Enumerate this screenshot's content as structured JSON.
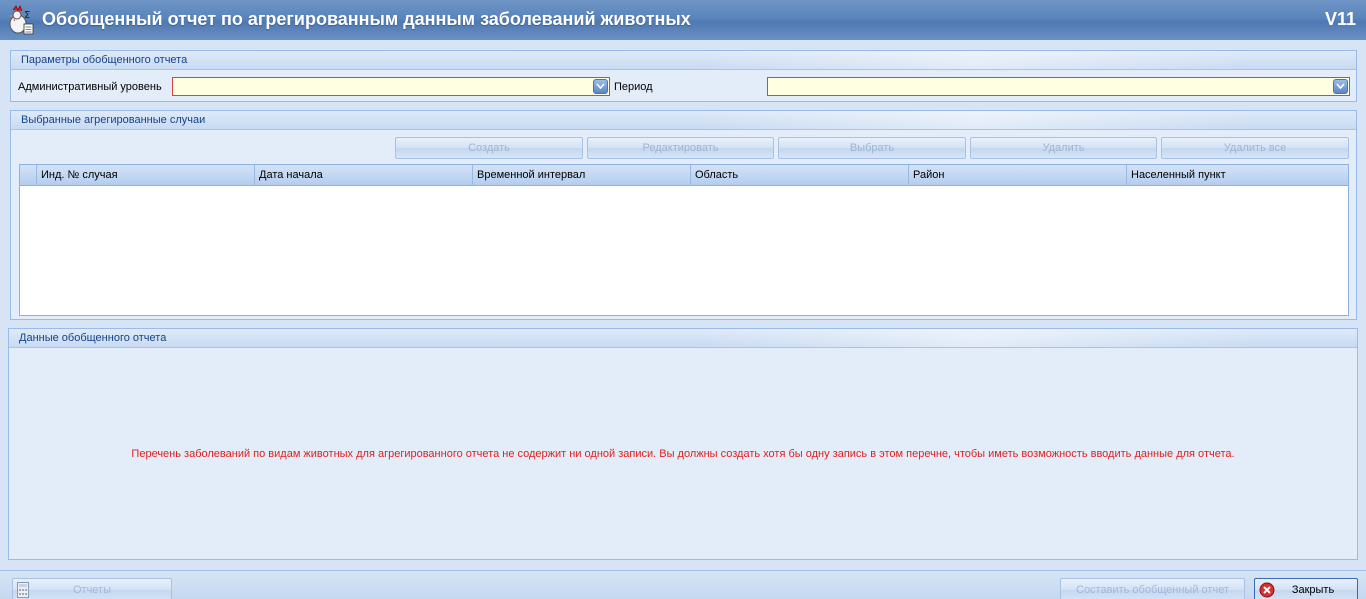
{
  "window": {
    "title": "Обобщенный отчет по агрегированным данным заболеваний животных",
    "version": "V11",
    "icon": "rooster-sigma-icon"
  },
  "params_panel": {
    "header": "Параметры обобщенного отчета",
    "admin_level_label": "Административный уровень",
    "admin_level_value": "",
    "period_label": "Период",
    "period_value": ""
  },
  "cases_panel": {
    "header": "Выбранные агрегированные случаи",
    "buttons": {
      "create": "Создать",
      "edit": "Редактировать",
      "select": "Выбрать",
      "delete": "Удалить",
      "delete_all": "Удалить все"
    },
    "columns": [
      "Инд. № случая",
      "Дата начала",
      "Временной интервал",
      "Область",
      "Район",
      "Населенный пункт"
    ],
    "rows": []
  },
  "data_panel": {
    "header": "Данные обобщенного отчета",
    "message": "Перечень заболеваний по видам животных для агрегированного отчета не содержит ни одной записи. Вы должны создать хотя бы одну запись в этом перечне, чтобы иметь возможность вводить данные для отчета."
  },
  "footer": {
    "reports_label": "Отчеты",
    "compose_label": "Составить обобщенный отчет",
    "close_label": "Закрыть"
  },
  "colors": {
    "titlebar": "#5a84bb",
    "required_border": "#e23f3f",
    "required_fill": "#ffffe1",
    "message": "#e01f1f"
  }
}
